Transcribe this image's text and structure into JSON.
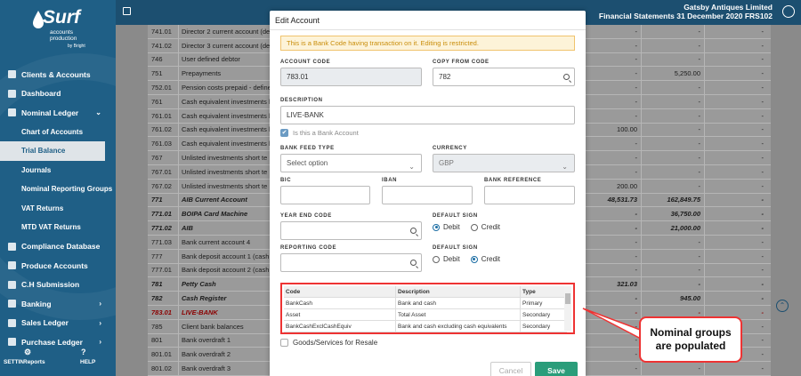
{
  "brand": {
    "name": "Surf",
    "sub1": "accounts",
    "sub2": "production",
    "by": "by Bright"
  },
  "sidebar": {
    "items": [
      {
        "label": "Clients & Accounts",
        "sub": false,
        "chevron": false
      },
      {
        "label": "Dashboard",
        "sub": false,
        "chevron": false
      },
      {
        "label": "Nominal Ledger",
        "sub": false,
        "chevron": true
      },
      {
        "label": "Chart of Accounts",
        "sub": true,
        "chevron": false
      },
      {
        "label": "Trial Balance",
        "sub": true,
        "active": true,
        "chevron": false
      },
      {
        "label": "Journals",
        "sub": true,
        "chevron": false
      },
      {
        "label": "Nominal Reporting Groups",
        "sub": true,
        "chevron": false
      },
      {
        "label": "VAT Returns",
        "sub": true,
        "chevron": false
      },
      {
        "label": "MTD VAT Returns",
        "sub": true,
        "chevron": false
      },
      {
        "label": "Compliance Database",
        "sub": false,
        "chevron": false
      },
      {
        "label": "Produce Accounts",
        "sub": false,
        "chevron": false
      },
      {
        "label": "C.H Submission",
        "sub": false,
        "chevron": false
      },
      {
        "label": "Banking",
        "sub": false,
        "chevron": true
      },
      {
        "label": "Sales Ledger",
        "sub": false,
        "chevron": true
      },
      {
        "label": "Purchase Ledger",
        "sub": false,
        "chevron": true
      }
    ],
    "bottom": {
      "settings": "SETTINGS",
      "reports": "Reports",
      "help": "HELP"
    }
  },
  "topbar": {
    "company": "Gatsby Antiques Limited",
    "statement": "Financial Statements 31 December 2020 FRS102"
  },
  "table": {
    "rows": [
      {
        "code": "741.01",
        "desc": "Director 2 current account (de",
        "v": [
          "-",
          "-",
          "-"
        ],
        "style": ""
      },
      {
        "code": "741.02",
        "desc": "Director 3 current account (de",
        "v": [
          "-",
          "-",
          "-"
        ],
        "style": ""
      },
      {
        "code": "746",
        "desc": "User defined debtor",
        "v": [
          "-",
          "-",
          "-"
        ],
        "style": ""
      },
      {
        "code": "751",
        "desc": "Prepayments",
        "v": [
          "-",
          "5,250.00",
          "-"
        ],
        "style": ""
      },
      {
        "code": "752.01",
        "desc": "Pension costs prepaid - define",
        "v": [
          "-",
          "-",
          "-"
        ],
        "style": ""
      },
      {
        "code": "761",
        "desc": "Cash equivalent investments l",
        "v": [
          "-",
          "-",
          "-"
        ],
        "style": ""
      },
      {
        "code": "761.01",
        "desc": "Cash equivalent investments l",
        "v": [
          "-",
          "-",
          "-"
        ],
        "style": ""
      },
      {
        "code": "761.02",
        "desc": "Cash equivalent investments l",
        "v": [
          "100.00",
          "-",
          "-"
        ],
        "style": ""
      },
      {
        "code": "761.03",
        "desc": "Cash equivalent investments l",
        "v": [
          "-",
          "-",
          "-"
        ],
        "style": ""
      },
      {
        "code": "767",
        "desc": "Unlisted investments short te",
        "v": [
          "-",
          "-",
          "-"
        ],
        "style": ""
      },
      {
        "code": "767.01",
        "desc": "Unlisted investments short te",
        "v": [
          "-",
          "-",
          "-"
        ],
        "style": ""
      },
      {
        "code": "767.02",
        "desc": "Unlisted investments short te",
        "v": [
          "200.00",
          "-",
          "-"
        ],
        "style": ""
      },
      {
        "code": "771",
        "desc": "AIB Current Account",
        "v": [
          "48,531.73",
          "162,849.75",
          "-"
        ],
        "style": "bold"
      },
      {
        "code": "771.01",
        "desc": "BOIPA Card Machine",
        "v": [
          "-",
          "36,750.00",
          "-"
        ],
        "style": "bold"
      },
      {
        "code": "771.02",
        "desc": "AIB",
        "v": [
          "-",
          "21,000.00",
          "-"
        ],
        "style": "bold"
      },
      {
        "code": "771.03",
        "desc": "Bank current account 4",
        "v": [
          "-",
          "-",
          "-"
        ],
        "style": ""
      },
      {
        "code": "777",
        "desc": "Bank deposit account 1 (cash",
        "v": [
          "-",
          "-",
          "-"
        ],
        "style": ""
      },
      {
        "code": "777.01",
        "desc": "Bank deposit account 2 (cash",
        "v": [
          "-",
          "-",
          "-"
        ],
        "style": ""
      },
      {
        "code": "781",
        "desc": "Petty Cash",
        "v": [
          "321.03",
          "-",
          "-"
        ],
        "style": "bold"
      },
      {
        "code": "782",
        "desc": "Cash Register",
        "v": [
          "-",
          "945.00",
          "-"
        ],
        "style": "bold"
      },
      {
        "code": "783.01",
        "desc": "LIVE-BANK",
        "v": [
          "-",
          "-",
          "-"
        ],
        "style": "red"
      },
      {
        "code": "785",
        "desc": "Client bank balances",
        "v": [
          "-",
          "-",
          "-"
        ],
        "style": ""
      },
      {
        "code": "801",
        "desc": "Bank overdraft 1",
        "v": [
          "-",
          "-",
          "-"
        ],
        "style": ""
      },
      {
        "code": "801.01",
        "desc": "Bank overdraft 2",
        "v": [
          "-",
          "-",
          "-"
        ],
        "style": ""
      },
      {
        "code": "801.02",
        "desc": "Bank overdraft 3",
        "v": [
          "-",
          "-",
          "-"
        ],
        "style": ""
      },
      {
        "code": "801.03",
        "desc": "Bank overdraft 4",
        "v": [
          "-",
          "-",
          "-"
        ],
        "style": ""
      }
    ]
  },
  "modal": {
    "title": "Edit Account",
    "alert": "This is a Bank Code having transaction on it. Editing is restricted.",
    "account_code_label": "ACCOUNT CODE",
    "account_code": "783.01",
    "copy_from_label": "COPY FROM CODE",
    "copy_from": "782",
    "description_label": "DESCRIPTION",
    "description": "LIVE-BANK",
    "is_bank_label": "Is this a Bank Account",
    "bank_feed_label": "BANK FEED TYPE",
    "bank_feed_placeholder": "Select option",
    "currency_label": "CURRENCY",
    "currency": "GBP",
    "bic_label": "BIC",
    "iban_label": "IBAN",
    "bank_ref_label": "BANK REFERENCE",
    "year_end_label": "YEAR END CODE",
    "default_sign_label": "DEFAULT SIGN",
    "reporting_code_label": "REPORTING CODE",
    "debit": "Debit",
    "credit": "Credit",
    "grid": {
      "headers": [
        "Code",
        "Description",
        "Type"
      ],
      "rows": [
        [
          "BankCash",
          "Bank and cash",
          "Primary"
        ],
        [
          "Asset",
          "Total Asset",
          "Secondary"
        ],
        [
          "BankCashExclCashEquiv",
          "Bank and cash excluding cash equivalents",
          "Secondary"
        ]
      ]
    },
    "goods_label": "Goods/Services for Resale",
    "cancel": "Cancel",
    "save": "Save"
  },
  "callout": {
    "line1": "Nominal groups",
    "line2": "are populated"
  },
  "colors": {
    "sidebar": "#1f5f86",
    "topbar": "#1c4f70",
    "save": "#2a9d7a",
    "highlight": "#ee3333"
  }
}
